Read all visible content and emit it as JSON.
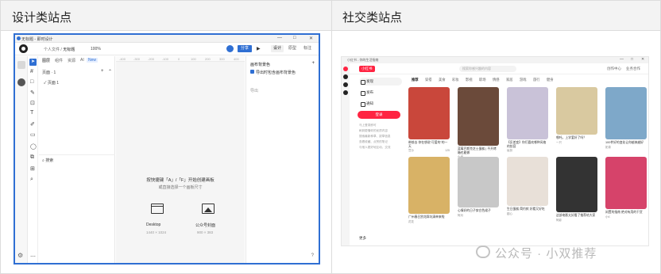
{
  "table": {
    "col1_header": "设计类站点",
    "col2_header": "社交类站点"
  },
  "design_app": {
    "window_title": "无标题 - 即时设计",
    "window_controls": [
      "—",
      "□",
      "✕"
    ],
    "breadcrumb_root": "个人文件",
    "breadcrumb_sep": "/",
    "breadcrumb_file": "无标题",
    "zoom": "100%",
    "share_label": "分享",
    "play_icon": "play-icon",
    "modes": [
      "设计",
      "原型",
      "标注"
    ],
    "layer_tabs": [
      "图层",
      "组件",
      "资源",
      "AI"
    ],
    "new_badge": "New",
    "pages_label": "页面 · 1",
    "page_item": "页面 1",
    "search_label": "搜索",
    "ruler_ticks": [
      "-400",
      "-300",
      "-200",
      "-100",
      "0",
      "100",
      "200",
      "300",
      "400"
    ],
    "hint_title": "按快捷键「A」/「F」开始创建画板",
    "hint_sub": "或直接选择一个画板尺寸",
    "presets": [
      {
        "label": "Desktop",
        "size": "1440 × 1024"
      },
      {
        "label": "公众号封面",
        "size": "900 × 383"
      }
    ],
    "props_title": "画布背景色",
    "props_checkbox": "导出时包含画布背景色",
    "props_export": "导出",
    "help": "?"
  },
  "social_app": {
    "window_title": "小红书 - 你的生活指南",
    "brand": "小红书",
    "search_placeholder": "搜索你感兴趣的内容",
    "nav_links": [
      "创作中心",
      "业务合作"
    ],
    "sidebar": [
      {
        "label": "发现"
      },
      {
        "label": "发布"
      },
      {
        "label": "通知"
      }
    ],
    "login": "登录",
    "tips": [
      "马上登录即可",
      "刷到更懂你的优质内容",
      "搜索最新种草、拔草信息",
      "查看收藏、点赞的笔记",
      "与他人更好地互动、交流"
    ],
    "more": "更多",
    "tabs": [
      "推荐",
      "穿搭",
      "美食",
      "彩妆",
      "影视",
      "职场",
      "情感",
      "家居",
      "游戏",
      "旅行",
      "健身"
    ],
    "cards": [
      {
        "caption": "带前去 你在想说\"可爱的\"的一天",
        "user": "豆沙",
        "likes": "125",
        "color": "#c9473b"
      },
      {
        "caption": "蓝莓巴斯克芝士蛋糕 | 不开烤箱也能做",
        "user": "小米",
        "likes": "",
        "color": "#6b4a3a"
      },
      {
        "caption": "【反差变】你们喜欢哪种风格的妆容",
        "user": "妆扮",
        "likes": "",
        "color": "#c9c2d8"
      },
      {
        "caption": "哪吒，上学爱好了吗？",
        "user": "一只",
        "likes": "",
        "color": "#d9c9a0"
      },
      {
        "caption": "100件好的变化让你越来越好",
        "user": "奶茶",
        "likes": "",
        "color": "#7ea8c9"
      },
      {
        "caption": "广州春日赏花踩坑清单来啦",
        "user": "花花",
        "likes": "",
        "color": "#d8b266"
      },
      {
        "caption": "心情好的日子穿白色裙子",
        "user": "阿月",
        "likes": "",
        "color": "#c8c8c8"
      },
      {
        "caption": "生日蛋糕 简约款 好看又好吃",
        "user": "甜心",
        "likes": "",
        "color": "#e8e0d8"
      },
      {
        "caption": "这部电影太好看了推荐给大家",
        "user": "阿影",
        "likes": "",
        "color": "#333333"
      },
      {
        "caption": "闲置的指南 绝对有用的干货",
        "user": "小K",
        "likes": "",
        "color": "#d6436a"
      }
    ]
  },
  "watermark": {
    "text": "公众号 · 小双推荐"
  }
}
